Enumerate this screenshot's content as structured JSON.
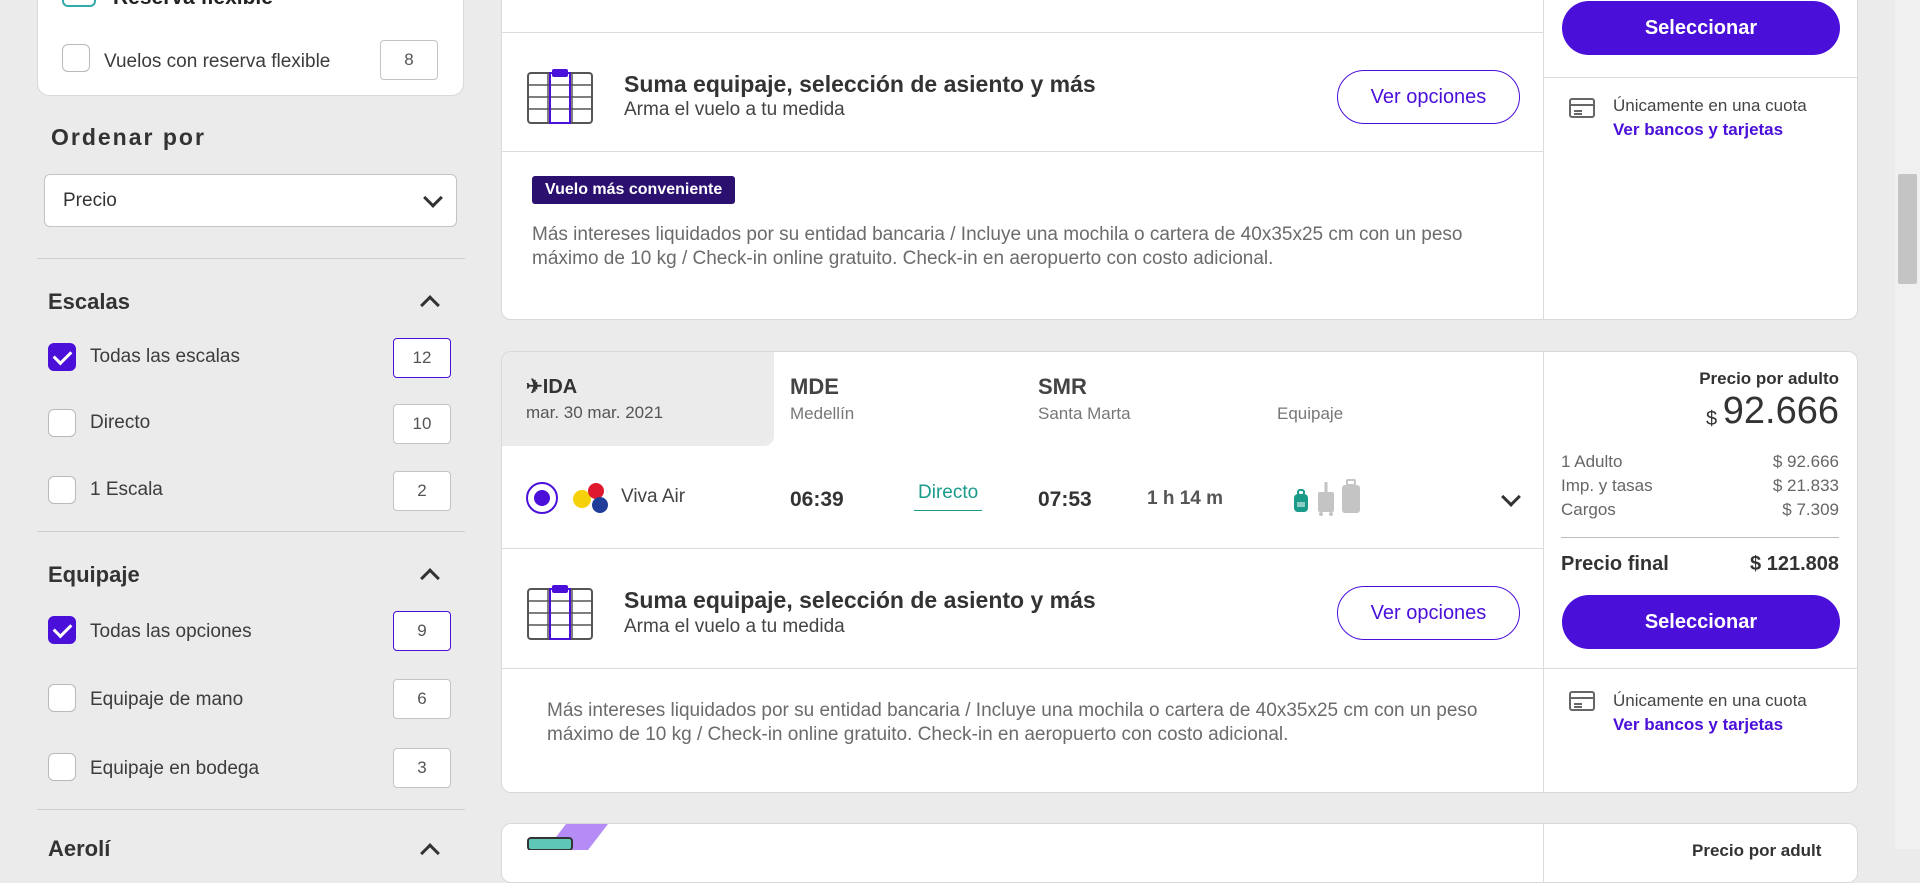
{
  "sidebar": {
    "flex_title": "Reserva flexible",
    "flex_option": {
      "label": "Vuelos con reserva flexible",
      "count": "8",
      "checked": false
    },
    "sort_title": "Ordenar por",
    "sort_value": "Precio",
    "stops": {
      "title": "Escalas",
      "options": [
        {
          "label": "Todas las escalas",
          "count": "12",
          "checked": true
        },
        {
          "label": "Directo",
          "count": "10",
          "checked": false
        },
        {
          "label": "1 Escala",
          "count": "2",
          "checked": false
        }
      ]
    },
    "baggage": {
      "title": "Equipaje",
      "options": [
        {
          "label": "Todas las opciones",
          "count": "9",
          "checked": true
        },
        {
          "label": "Equipaje de mano",
          "count": "6",
          "checked": false
        },
        {
          "label": "Equipaje en bodega",
          "count": "3",
          "checked": false
        }
      ]
    },
    "next_section_partial": "Aerolí"
  },
  "card1": {
    "select_label": "Seleccionar",
    "upsell_title": "Suma equipaje, selección de asiento y más",
    "upsell_sub": "Arma el vuelo a tu medida",
    "upsell_btn": "Ver opciones",
    "pay_text": "Únicamente en una cuota",
    "pay_link": "Ver bancos y tarjetas",
    "badge": "Vuelo más conveniente",
    "description": "Más intereses liquidados por su entidad bancaria / Incluye una mochila o cartera de 40x35x25 cm con un peso máximo de 10 kg / Check-in online gratuito. Check-in en aeropuerto con costo adicional."
  },
  "card2": {
    "ida_label": "✈IDA",
    "date": "mar. 30 mar. 2021",
    "origin_code": "MDE",
    "origin_city": "Medellín",
    "dest_code": "SMR",
    "dest_city": "Santa Marta",
    "baggage_label": "Equipaje",
    "airline": "Viva Air",
    "depart": "06:39",
    "stops": "Directo",
    "arrive": "07:53",
    "duration": "1 h 14 m",
    "price_label": "Precio por adulto",
    "currency": "$",
    "price": "92.666",
    "breakdown": [
      {
        "label": "1 Adulto",
        "value": "$ 92.666"
      },
      {
        "label": "Imp. y tasas",
        "value": "$ 21.833"
      },
      {
        "label": "Cargos",
        "value": "$ 7.309"
      }
    ],
    "final_label": "Precio final",
    "final_value": "$ 121.808",
    "select_label": "Seleccionar",
    "upsell_title": "Suma equipaje, selección de asiento y más",
    "upsell_sub": "Arma el vuelo a tu medida",
    "upsell_btn": "Ver opciones",
    "pay_text": "Únicamente en una cuota",
    "pay_link": "Ver bancos y tarjetas",
    "description": "Más intereses liquidados por su entidad bancaria / Incluye una mochila o cartera de 40x35x25 cm con un peso máximo de 10 kg / Check-in online gratuito. Check-in en aeropuerto con costo adicional."
  },
  "card3": {
    "price_label_partial": "Precio por adult"
  },
  "colors": {
    "accent": "#4a0fd9",
    "direct": "#1a9b8a",
    "badge": "#2b1070"
  }
}
